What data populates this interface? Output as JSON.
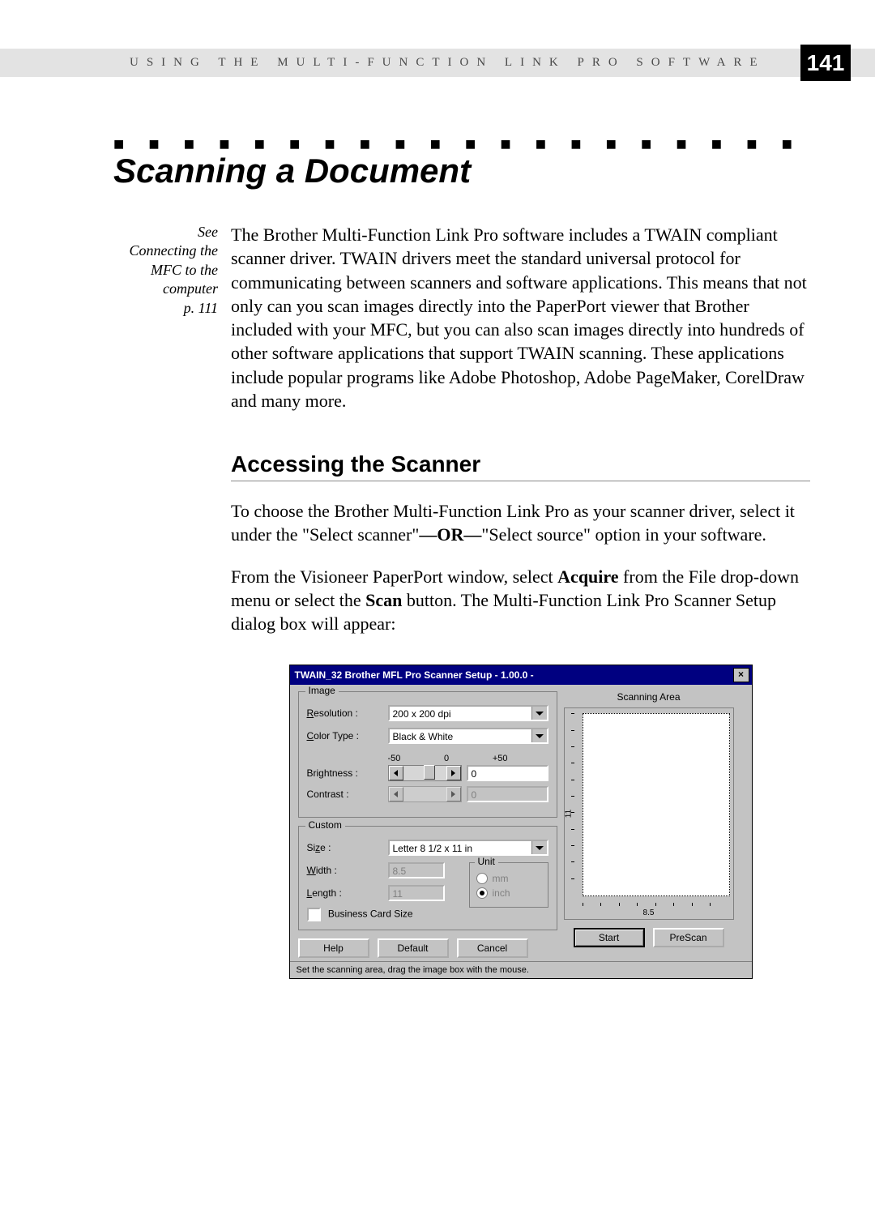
{
  "header": {
    "running_head": "USING THE MULTI-FUNCTION LINK PRO SOFTWARE",
    "page_number": "141"
  },
  "dotted_rule": "■ ■ ■ ■ ■ ■ ■ ■ ■ ■ ■ ■ ■ ■ ■ ■ ■ ■ ■ ■ ■ ■ ■ ■ ■ ■ ■ ■ ■ ■ ■ ■ ■ ■ ■ ■ ■ ■ ■ ■ ■ ■ ■ ■ ■ ■ ■ ■ ■ ■ ■",
  "h1": "Scanning a Document",
  "margin_note": {
    "l1": "See",
    "l2": "Connecting the",
    "l3": "MFC to the",
    "l4": "computer",
    "l5": "p. 111"
  },
  "intro": "The Brother Multi-Function Link Pro software includes a TWAIN compliant scanner driver.  TWAIN drivers meet the standard universal protocol for communicating between scanners and software applications.  This means that not only can you scan images directly into the PaperPort viewer that Brother included with your MFC, but you can also scan images directly into hundreds of other software applications that support TWAIN scanning.  These applications include popular programs like Adobe Photoshop, Adobe PageMaker, CorelDraw and many more.",
  "h2": "Accessing the Scanner",
  "para2_a": "To choose the Brother Multi-Function Link Pro as your scanner driver, select it under the \"Select scanner\"",
  "para2_or": "—OR—",
  "para2_b": "\"Select source\" option in your software.",
  "para3_a": "From the Visioneer PaperPort window, select ",
  "para3_acquire": "Acquire",
  "para3_b": " from the File drop-down menu or select the ",
  "para3_scan": "Scan",
  "para3_c": " button. The Multi-Function Link Pro Scanner Setup dialog box will appear:",
  "dlg": {
    "title": "TWAIN_32 Brother MFL Pro Scanner Setup - 1.00.0 -",
    "close": "×",
    "image_group": "Image",
    "resolution_label": "Resolution :",
    "resolution_value": "200 x 200 dpi",
    "color_label": "Color Type :",
    "color_value": "Black & White",
    "tick_m50": "-50",
    "tick_0": "0",
    "tick_p50": "+50",
    "brightness_label": "Brightness :",
    "brightness_value": "0",
    "contrast_label": "Contrast :",
    "contrast_value": "0",
    "custom_group": "Custom",
    "size_label": "Size :",
    "size_value": "Letter 8 1/2 x 11 in",
    "width_label": "Width :",
    "width_value": "8.5",
    "length_label": "Length :",
    "length_value": "11",
    "unit_group": "Unit",
    "unit_mm": "mm",
    "unit_inch": "inch",
    "business_card": "Business Card Size",
    "help_btn": "Help",
    "default_btn": "Default",
    "cancel_btn": "Cancel",
    "scanning_area": "Scanning Area",
    "ruler_h": "8.5",
    "ruler_v": "11",
    "start_btn": "Start",
    "prescan_btn": "PreScan",
    "status": "Set the scanning area, drag the image box with the mouse."
  }
}
